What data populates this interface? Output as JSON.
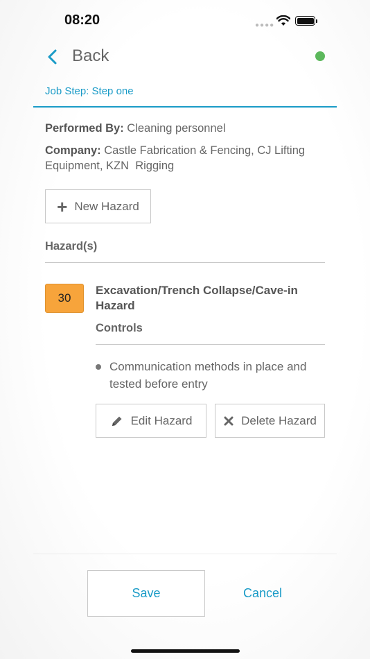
{
  "status_bar": {
    "time": "08:20",
    "signal_icon": "signal-dots-icon",
    "wifi_icon": "wifi-icon",
    "battery_icon": "battery-icon"
  },
  "nav": {
    "back_label": "Back",
    "back_icon": "chevron-left-icon",
    "status_dot_color": "#5cb85c"
  },
  "job_step": {
    "label": "Job Step: Step one"
  },
  "info": {
    "performed_by_label": "Performed By:",
    "performed_by_value": "Cleaning personnel",
    "company_label": "Company:",
    "company_value": "Castle Fabrication & Fencing, CJ Lifting Equipment, KZN  Rigging"
  },
  "actions": {
    "new_hazard_label": "New Hazard",
    "new_hazard_icon": "plus-icon"
  },
  "hazards": {
    "heading": "Hazard(s)",
    "items": [
      {
        "score": "30",
        "score_color": "#f7a43b",
        "title": "Excavation/Trench Collapse/Cave-in Hazard",
        "controls_heading": "Controls",
        "controls": [
          "Communication methods in place and tested before entry"
        ],
        "edit_label": "Edit Hazard",
        "edit_icon": "pencil-icon",
        "delete_label": "Delete Hazard",
        "delete_icon": "x-icon"
      }
    ]
  },
  "footer": {
    "save_label": "Save",
    "cancel_label": "Cancel"
  },
  "colors": {
    "accent": "#1a9bc7",
    "online": "#5cb85c",
    "risk_score": "#f7a43b"
  }
}
